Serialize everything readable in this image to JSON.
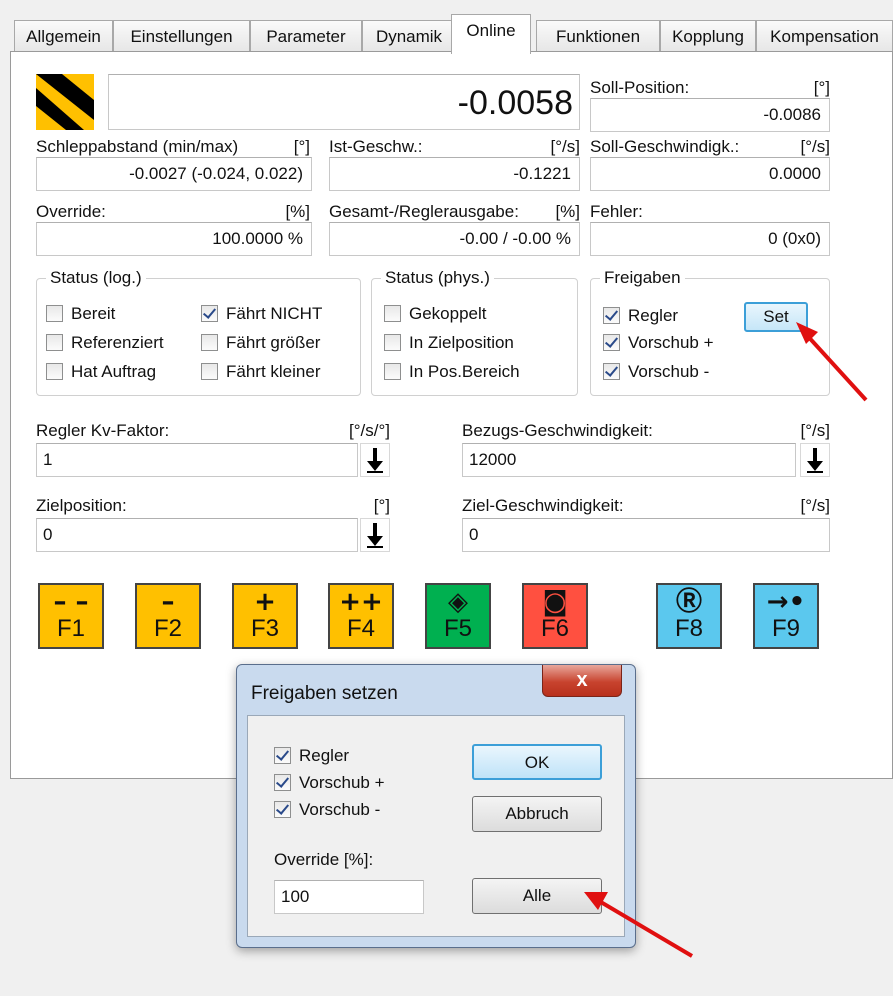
{
  "tabs": [
    {
      "label": "Allgemein",
      "active": false
    },
    {
      "label": "Einstellungen",
      "active": false
    },
    {
      "label": "Parameter",
      "active": false
    },
    {
      "label": "Dynamik",
      "active": false
    },
    {
      "label": "Online",
      "active": true
    },
    {
      "label": "Funktionen",
      "active": false
    },
    {
      "label": "Kopplung",
      "active": false
    },
    {
      "label": "Kompensation",
      "active": false
    }
  ],
  "online": {
    "main_value": "-0.0058",
    "soll_position": {
      "label": "Soll-Position:",
      "unit": "[°]",
      "value": "-0.0086"
    },
    "schleppabstand": {
      "label": "Schleppabstand (min/max)",
      "unit": "[°]",
      "value": "-0.0027  (-0.024, 0.022)"
    },
    "ist_geschw": {
      "label": "Ist-Geschw.:",
      "unit": "[°/s]",
      "value": "-0.1221"
    },
    "soll_geschw": {
      "label": "Soll-Geschwindigk.:",
      "unit": "[°/s]",
      "value": "0.0000"
    },
    "override": {
      "label": "Override:",
      "unit": "[%]",
      "value": "100.0000 %"
    },
    "gesamt": {
      "label": "Gesamt-/Reglerausgabe:",
      "unit": "[%]",
      "value": "-0.00 / -0.00 %"
    },
    "fehler": {
      "label": "Fehler:",
      "value": "0 (0x0)"
    }
  },
  "status_log": {
    "title": "Status (log.)",
    "items": [
      {
        "label": "Bereit",
        "checked": false
      },
      {
        "label": "Referenziert",
        "checked": false
      },
      {
        "label": "Hat Auftrag",
        "checked": false
      },
      {
        "label": "Fährt NICHT",
        "checked": true
      },
      {
        "label": "Fährt größer",
        "checked": false
      },
      {
        "label": "Fährt kleiner",
        "checked": false
      }
    ]
  },
  "status_phys": {
    "title": "Status (phys.)",
    "items": [
      {
        "label": "Gekoppelt",
        "checked": false
      },
      {
        "label": "In Zielposition",
        "checked": false
      },
      {
        "label": "In Pos.Bereich",
        "checked": false
      }
    ]
  },
  "freigaben": {
    "title": "Freigaben",
    "items": [
      {
        "label": "Regler",
        "checked": true
      },
      {
        "label": "Vorschub +",
        "checked": true
      },
      {
        "label": "Vorschub -",
        "checked": true
      }
    ],
    "set_label": "Set"
  },
  "params": {
    "kv": {
      "label": "Regler Kv-Faktor:",
      "unit": "[°/s/°]",
      "value": "1"
    },
    "bezug": {
      "label": "Bezugs-Geschwindigkeit:",
      "unit": "[°/s]",
      "value": "12000"
    },
    "zielpos": {
      "label": "Zielposition:",
      "unit": "[°]",
      "value": "0"
    },
    "zielgeschw": {
      "label": "Ziel-Geschwindigkeit:",
      "unit": "[°/s]",
      "value": "0"
    }
  },
  "fbuttons": [
    {
      "sym": "– –",
      "key": "F1",
      "color": "#ffc000"
    },
    {
      "sym": "–",
      "key": "F2",
      "color": "#ffc000"
    },
    {
      "sym": "+",
      "key": "F3",
      "color": "#ffc000"
    },
    {
      "sym": "++",
      "key": "F4",
      "color": "#ffc000"
    },
    {
      "sym": "◈",
      "key": "F5",
      "color": "#00b050"
    },
    {
      "sym": "◙",
      "key": "F6",
      "color": "#ff5040"
    },
    {
      "sym": "Ⓡ",
      "key": "F8",
      "color": "#5bc8ee"
    },
    {
      "sym": "→•",
      "key": "F9",
      "color": "#5bc8ee"
    }
  ],
  "dialog": {
    "title": "Freigaben setzen",
    "close": "x",
    "items": [
      {
        "label": "Regler",
        "checked": true
      },
      {
        "label": "Vorschub +",
        "checked": true
      },
      {
        "label": "Vorschub -",
        "checked": true
      }
    ],
    "ok": "OK",
    "cancel": "Abbruch",
    "override_label": "Override [%]:",
    "override_value": "100",
    "alle": "Alle"
  }
}
